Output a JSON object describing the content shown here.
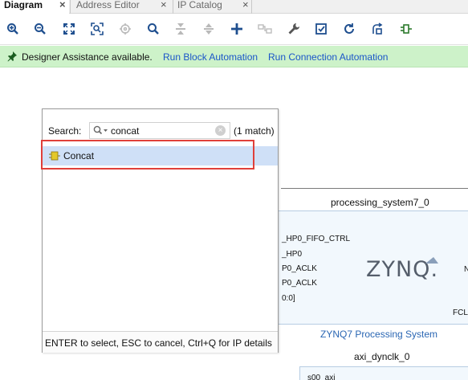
{
  "tabs": [
    {
      "label": "Diagram",
      "active": true
    },
    {
      "label": "Address Editor",
      "active": false
    },
    {
      "label": "IP Catalog",
      "active": false
    }
  ],
  "tab_close_glyph": "×",
  "toolbar": {
    "icons": [
      "zoom-in-icon",
      "zoom-out-icon",
      "fit-full-icon",
      "zoom-area-icon",
      "target-icon",
      "search-icon",
      "collapse-icon",
      "expand-icon",
      "add-ip-icon",
      "connect-icon",
      "wrench-icon",
      "validate-icon",
      "refresh-icon",
      "regenerate-layout-icon",
      "pin-icon"
    ]
  },
  "assistance": {
    "message": "Designer Assistance available.",
    "link_block": "Run Block Automation",
    "link_connection": "Run Connection Automation"
  },
  "popup": {
    "search_label": "Search:",
    "search_value": "concat",
    "match_text": "(1 match)",
    "result_label": "Concat",
    "footer_text": "ENTER to select, ESC to cancel, Ctrl+Q for IP details"
  },
  "processing_system": {
    "title": "processing_system7_0",
    "ports": [
      "_HP0_FIFO_CTRL",
      "_HP0",
      "P0_ACLK",
      "P0_ACLK",
      "0:0]"
    ],
    "right_port_1": "N",
    "right_port_2": "FCL",
    "logo": "ZYNQ.",
    "subtitle": "ZYNQ7 Processing System"
  },
  "axi_dynclk": {
    "title": "axi_dynclk_0",
    "port": "s00_axi"
  },
  "colors": {
    "assist_bg": "#cdf2c9",
    "link": "#1a55c9",
    "highlight_border": "#e0403a",
    "result_bg": "#cfe0f7"
  }
}
